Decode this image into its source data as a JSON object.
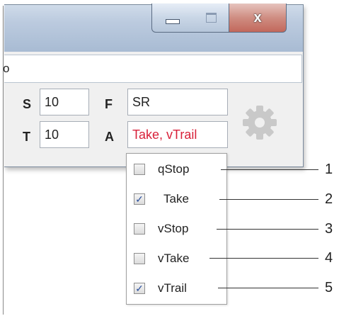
{
  "window": {
    "caption_buttons": {
      "minimize_icon": "minimize-icon",
      "maximize_icon": "maximize-icon",
      "close_icon": "close-icon",
      "close_glyph": "x"
    },
    "address_text": "o"
  },
  "form": {
    "s_label": "S",
    "s_value": "10",
    "f_label": "F",
    "f_value": "SR",
    "t_label": "T",
    "t_value": "10",
    "a_label": "A",
    "a_value": "Take, vTrail",
    "a_value_color": "#d8213a",
    "settings_icon": "gear-icon"
  },
  "dropdown": {
    "options": [
      {
        "label": "qStop",
        "checked": false
      },
      {
        "label": "Take",
        "checked": true
      },
      {
        "label": "vStop",
        "checked": false
      },
      {
        "label": "vTake",
        "checked": false
      },
      {
        "label": "vTrail",
        "checked": true
      }
    ],
    "check_mark": "✓"
  },
  "callouts": [
    "1",
    "2",
    "3",
    "4",
    "5"
  ]
}
